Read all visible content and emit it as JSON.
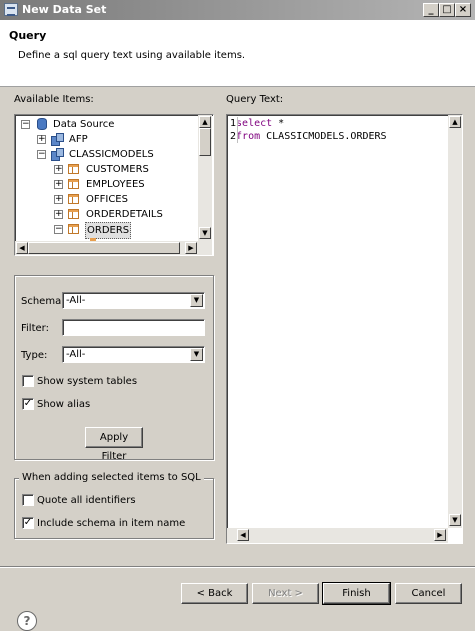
{
  "window": {
    "title": "New Data Set"
  },
  "header": {
    "title": "Query",
    "description": "Define a sql query text using available items."
  },
  "available_items": {
    "label": "Available Items:",
    "tree": [
      {
        "label": "Data Source",
        "expander": "−",
        "icon": "database-icon",
        "level": 0
      },
      {
        "label": "AFP",
        "expander": "+",
        "icon": "schema-icon",
        "level": 1
      },
      {
        "label": "CLASSICMODELS",
        "expander": "−",
        "icon": "schema-icon",
        "level": 1
      },
      {
        "label": "CUSTOMERS",
        "expander": "+",
        "icon": "table-icon",
        "level": 2
      },
      {
        "label": "EMPLOYEES",
        "expander": "+",
        "icon": "table-icon",
        "level": 2
      },
      {
        "label": "OFFICES",
        "expander": "+",
        "icon": "table-icon",
        "level": 2
      },
      {
        "label": "ORDERDETAILS",
        "expander": "+",
        "icon": "table-icon",
        "level": 2
      },
      {
        "label": "ORDERS",
        "expander": "−",
        "icon": "table-icon",
        "level": 2,
        "selected": true
      }
    ]
  },
  "filters": {
    "schema_label": "Schema:",
    "schema_value": "-All-",
    "filter_label": "Filter:",
    "filter_value": "",
    "type_label": "Type:",
    "type_value": "-All-",
    "show_system_tables": {
      "label": "Show system tables",
      "checked": false,
      "mark": ""
    },
    "show_alias": {
      "label": "Show alias",
      "checked": true,
      "mark": "✓"
    },
    "apply_button": "Apply Filter"
  },
  "sql_options": {
    "legend": "When adding selected items to SQL",
    "quote_all": {
      "label": "Quote all identifiers",
      "checked": false,
      "mark": ""
    },
    "include_schema": {
      "label": "Include schema in item name",
      "checked": true,
      "mark": "✓"
    }
  },
  "query": {
    "label": "Query Text:",
    "lines": [
      {
        "num": "1",
        "keyword": "select",
        "rest": " *"
      },
      {
        "num": "2",
        "keyword": "from",
        "rest": " CLASSICMODELS.ORDERS"
      }
    ]
  },
  "footer": {
    "back_button": "< Back",
    "next_button": "Next >",
    "finish_button": "Finish",
    "cancel_button": "Cancel"
  },
  "icons": {
    "help": "?",
    "minimize": "_",
    "maximize": "□",
    "close": "×"
  }
}
